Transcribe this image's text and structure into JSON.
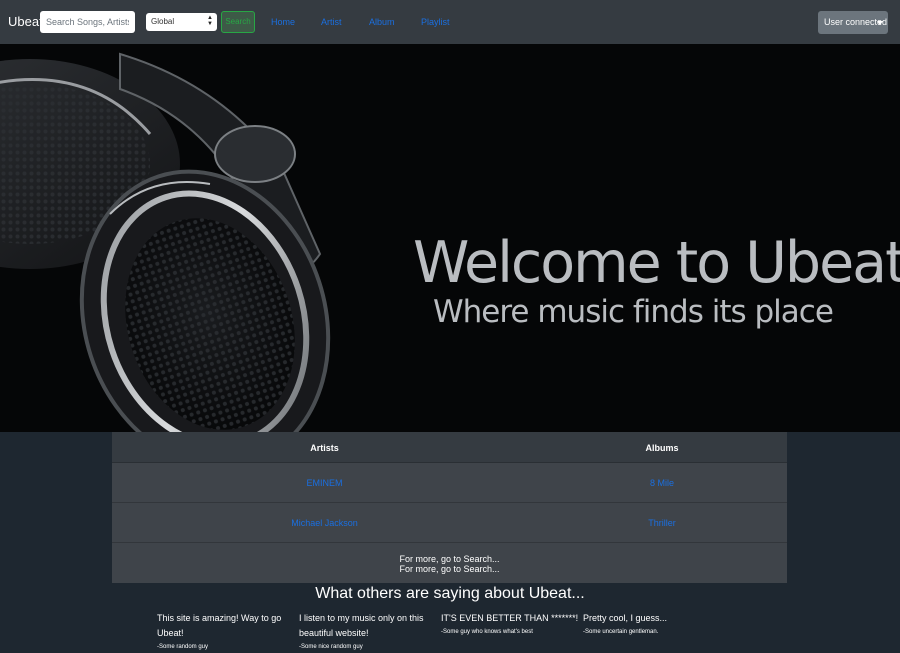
{
  "navbar": {
    "brand": "Ubeat",
    "search_placeholder": "Search Songs, Artists, A",
    "scope_selected": "Global",
    "search_button": "Search",
    "links": [
      "Home",
      "Artist",
      "Album",
      "Playlist"
    ],
    "user_menu": "User connected"
  },
  "hero": {
    "title": "Welcome to Ubeat!",
    "subtitle": "Where music finds its place"
  },
  "table": {
    "headers": [
      "Artists",
      "Albums"
    ],
    "rows": [
      {
        "artist": "EMINEM",
        "album": "8 Mile"
      },
      {
        "artist": "Michael Jackson",
        "album": "Thriller"
      }
    ],
    "more_lines": [
      "For more, go to Search...",
      "For more, go to Search..."
    ]
  },
  "reviews": {
    "title": "What others are saying about Ubeat...",
    "items": [
      {
        "quote": "This site is amazing! Way to go Ubeat!",
        "author": "-Some random guy"
      },
      {
        "quote": "I listen to my music only on this beautiful website!",
        "author": "-Some nice random guy"
      },
      {
        "quote": "IT'S EVEN BETTER THAN *******!",
        "author": "-Some guy who knows what's best"
      },
      {
        "quote": "Pretty cool, I guess...",
        "author": "-Some uncertain gentleman."
      }
    ]
  },
  "colors": {
    "navbar_bg": "#353b41",
    "page_bg": "#1e2730",
    "link": "#1a6fe0",
    "success": "#28a745",
    "secondary": "#6c757d"
  }
}
